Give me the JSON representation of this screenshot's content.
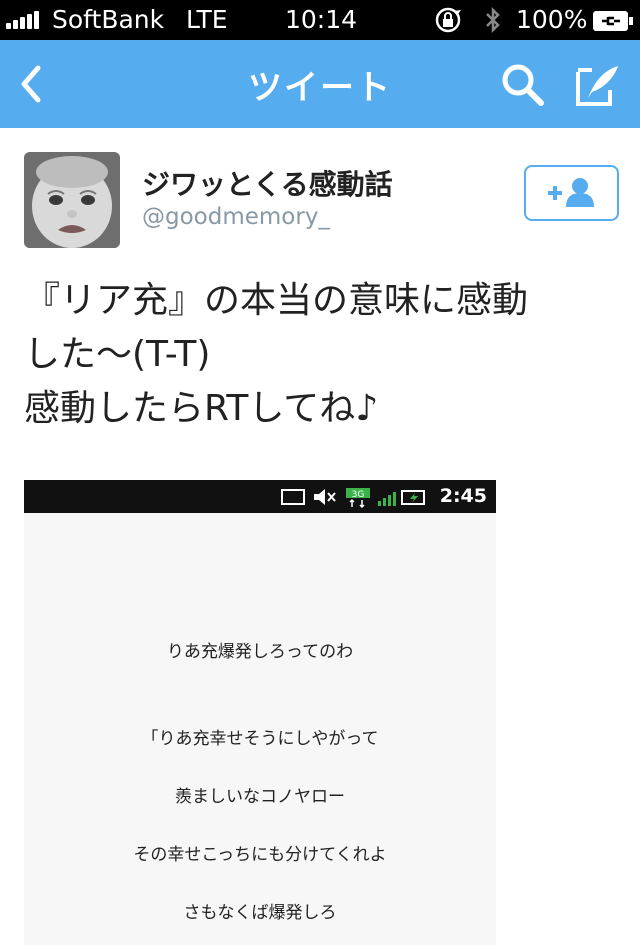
{
  "status_bar": {
    "carrier": "SoftBank",
    "network": "LTE",
    "time": "10:14",
    "battery": "100%"
  },
  "nav": {
    "title": "ツイート",
    "icons": [
      "back-chevron-icon",
      "search-icon",
      "compose-tweet-icon"
    ]
  },
  "profile": {
    "name": "ジワッとくる感動話",
    "handle": "@goodmemory_",
    "follow_icon": "add-user-icon"
  },
  "tweet": {
    "lines": [
      "『リア充』の本当の意味に感動",
      "した〜(T-T)",
      "感動したらRTしてね♪"
    ]
  },
  "media": {
    "status_time": "2:45",
    "status_network": "3G",
    "lines": [
      "りあ充爆発しろってのわ",
      "「りあ充幸せそうにしやがって",
      "羨ましいなコノヤロー",
      "その幸せこっちにも分けてくれよ",
      "さもなくば爆発しろ"
    ]
  },
  "colors": {
    "nav_blue": "#55acee",
    "status_black": "#000000",
    "text_dark": "#222222",
    "handle_gray": "#8899a6"
  }
}
